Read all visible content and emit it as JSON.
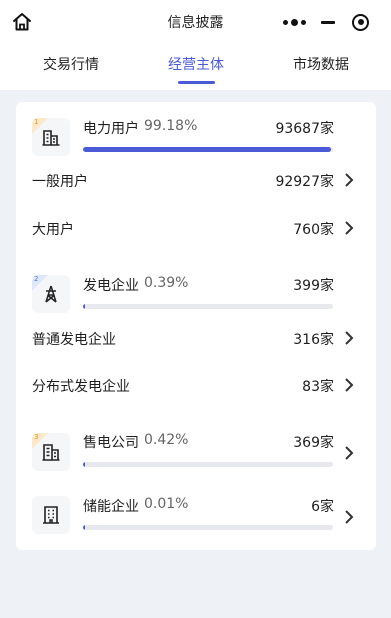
{
  "header": {
    "title": "信息披露"
  },
  "tabs": [
    {
      "label": "交易行情",
      "active": false
    },
    {
      "label": "经营主体",
      "active": true
    },
    {
      "label": "市场数据",
      "active": false
    }
  ],
  "accent_color": "#4b5ad6",
  "categories": [
    {
      "rank": "1",
      "icon": "building-icon",
      "name": "电力用户",
      "percent": "99.18%",
      "percent_value": 99.18,
      "count": "93687家",
      "subs": [
        {
          "name": "一般用户",
          "count": "92927家"
        },
        {
          "name": "大用户",
          "count": "760家"
        }
      ]
    },
    {
      "rank": "2",
      "icon": "power-tower-icon",
      "name": "发电企业",
      "percent": "0.39%",
      "percent_value": 0.39,
      "count": "399家",
      "subs": [
        {
          "name": "普通发电企业",
          "count": "316家"
        },
        {
          "name": "分布式发电企业",
          "count": "83家"
        }
      ]
    },
    {
      "rank": "3",
      "icon": "office-building-icon",
      "name": "售电公司",
      "percent": "0.42%",
      "percent_value": 0.42,
      "count": "369家",
      "subs": []
    },
    {
      "rank": "",
      "icon": "storage-building-icon",
      "name": "储能企业",
      "percent": "0.01%",
      "percent_value": 0.01,
      "count": "6家",
      "subs": []
    }
  ]
}
